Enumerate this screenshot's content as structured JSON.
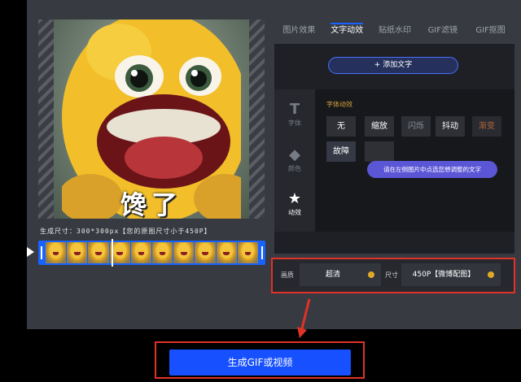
{
  "preview": {
    "caption": "馋了",
    "size_note": "生成尺寸：300*300px【您的原图尺寸小于450P】"
  },
  "timeline": {
    "frame_count": 10
  },
  "tabs": [
    {
      "label": "图片效果"
    },
    {
      "label": "文字动效",
      "active": true
    },
    {
      "label": "贴纸水印"
    },
    {
      "label": "GIF滤镜"
    },
    {
      "label": "GIF抠图"
    }
  ],
  "panel": {
    "add_text": "+ 添加文字",
    "tools": [
      {
        "glyph": "T",
        "label": "字体"
      },
      {
        "glyph": "◆",
        "label": "颜色"
      },
      {
        "glyph": "★",
        "label": "动效"
      }
    ],
    "effects_title": "字体动效",
    "effects": [
      "无",
      "缩放",
      "闪烁",
      "抖动",
      "渐变",
      "故障",
      ""
    ],
    "hint": "请在左侧图片中点选您想调整的文字"
  },
  "settings": {
    "quality_label": "画质",
    "quality_value": "超清",
    "size_label": "尺寸",
    "size_value": "450P【微博配图】"
  },
  "generate": {
    "label": "生成GIF或视频"
  },
  "colors": {
    "accent": "#1650ff",
    "highlight": "#e03226",
    "hint": "#5b56d6",
    "gold": "#d6a23a"
  }
}
